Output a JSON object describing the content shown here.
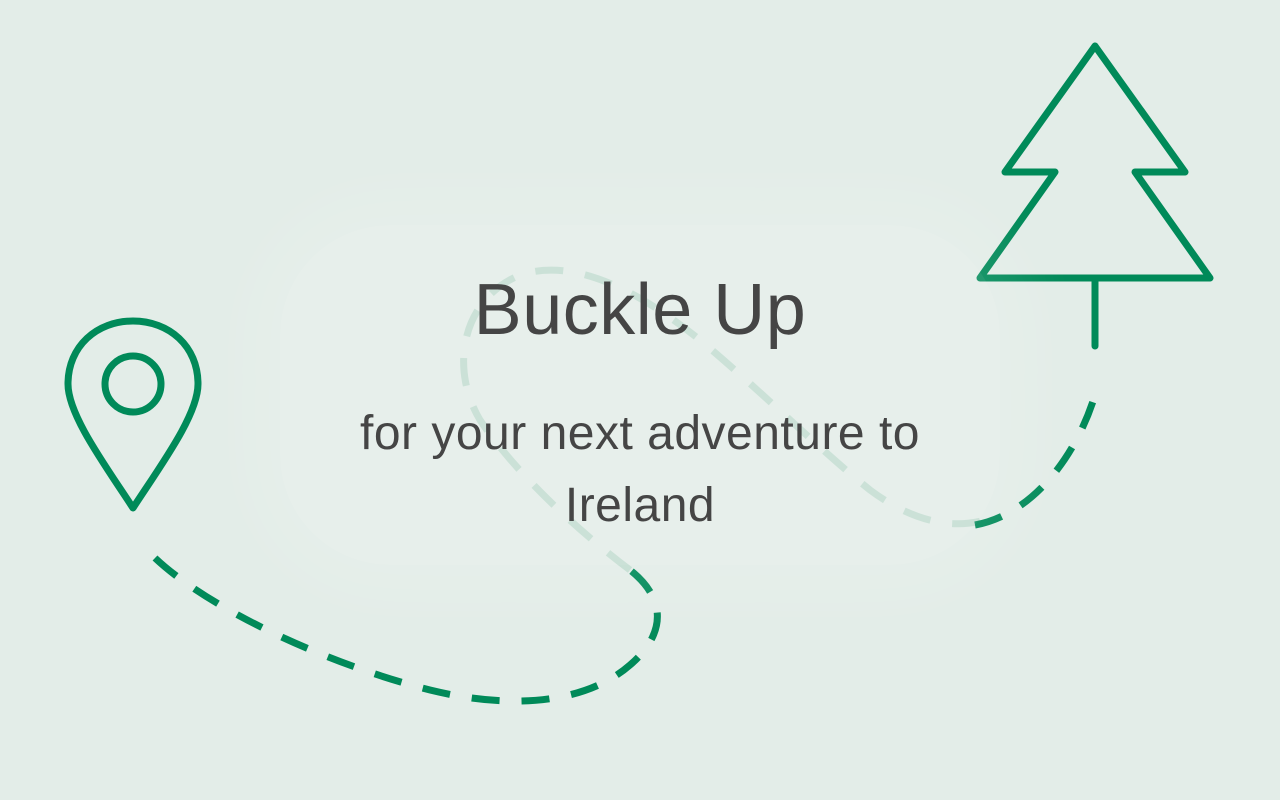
{
  "hero": {
    "title": "Buckle Up",
    "subtitle": "for your next adventure to Ireland"
  },
  "icons": {
    "start": "map-pin-icon",
    "end": "pine-tree-icon"
  },
  "colors": {
    "background": "#e3ede8",
    "accent": "#008a59",
    "path_faded": "#c3ddd1",
    "text": "#454545"
  }
}
